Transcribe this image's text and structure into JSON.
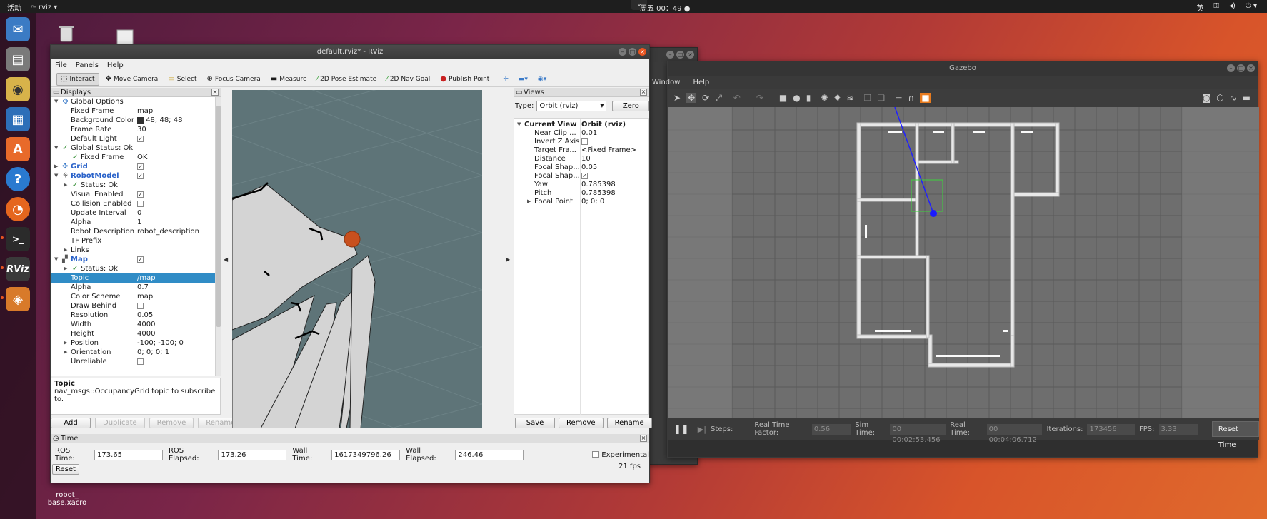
{
  "topbar": {
    "activities": "活动",
    "app_name": "rviz",
    "clock": "周五 00：49 ●",
    "input_method": "英"
  },
  "desktop": {
    "file_label_1": "robot_",
    "file_label_2": "base.xacro"
  },
  "rviz": {
    "title": "default.rviz* - RViz",
    "menu": {
      "file": "File",
      "panels": "Panels",
      "help": "Help"
    },
    "tools": {
      "interact": "Interact",
      "move_camera": "Move Camera",
      "select": "Select",
      "focus_camera": "Focus Camera",
      "measure": "Measure",
      "pose_estimate": "2D Pose Estimate",
      "nav_goal": "2D Nav Goal",
      "publish_point": "Publish Point"
    },
    "displays": {
      "header": "Displays",
      "rows": {
        "global_options": "Global Options",
        "fixed_frame_k": "Fixed Frame",
        "fixed_frame_v": "map",
        "bg_color_k": "Background Color",
        "bg_color_v": "48; 48; 48",
        "frame_rate_k": "Frame Rate",
        "frame_rate_v": "30",
        "default_light_k": "Default Light",
        "global_status": "Global Status: Ok",
        "gs_fixed_frame_k": "Fixed Frame",
        "gs_fixed_frame_v": "OK",
        "grid": "Grid",
        "robot_model": "RobotModel",
        "rm_status": "Status: Ok",
        "visual_enabled": "Visual Enabled",
        "collision_enabled": "Collision Enabled",
        "update_interval_k": "Update Interval",
        "update_interval_v": "0",
        "alpha_k": "Alpha",
        "alpha_v": "1",
        "robot_desc_k": "Robot Description",
        "robot_desc_v": "robot_description",
        "tf_prefix": "TF Prefix",
        "links": "Links",
        "map": "Map",
        "map_status": "Status: Ok",
        "topic_k": "Topic",
        "topic_v": "/map",
        "map_alpha_k": "Alpha",
        "map_alpha_v": "0.7",
        "color_scheme_k": "Color Scheme",
        "color_scheme_v": "map",
        "draw_behind": "Draw Behind",
        "resolution_k": "Resolution",
        "resolution_v": "0.05",
        "width_k": "Width",
        "width_v": "4000",
        "height_k": "Height",
        "height_v": "4000",
        "position_k": "Position",
        "position_v": "-100; -100; 0",
        "orientation_k": "Orientation",
        "orientation_v": "0; 0; 0; 1",
        "unreliable": "Unreliable"
      },
      "desc_title": "Topic",
      "desc_text": "nav_msgs::OccupancyGrid topic to subscribe to.",
      "buttons": {
        "add": "Add",
        "duplicate": "Duplicate",
        "remove": "Remove",
        "rename": "Rename"
      }
    },
    "views": {
      "header": "Views",
      "type_label": "Type:",
      "type_value": "Orbit (rviz)",
      "zero": "Zero",
      "rows": {
        "current_view_k": "Current View",
        "current_view_v": "Orbit (rviz)",
        "near_clip_k": "Near Clip ...",
        "near_clip_v": "0.01",
        "invert_z_k": "Invert Z Axis",
        "target_frame_k": "Target Fra...",
        "target_frame_v": "<Fixed Frame>",
        "distance_k": "Distance",
        "distance_v": "10",
        "focal_shape1_k": "Focal Shap...",
        "focal_shape1_v": "0.05",
        "focal_shape2_k": "Focal Shap...",
        "yaw_k": "Yaw",
        "yaw_v": "0.785398",
        "pitch_k": "Pitch",
        "pitch_v": "0.785398",
        "focal_point_k": "Focal Point",
        "focal_point_v": "0; 0; 0"
      },
      "buttons": {
        "save": "Save",
        "remove": "Remove",
        "rename": "Rename"
      }
    },
    "time": {
      "header": "Time",
      "ros_time_label": "ROS Time:",
      "ros_time": "173.65",
      "ros_elapsed_label": "ROS Elapsed:",
      "ros_elapsed": "173.26",
      "wall_time_label": "Wall Time:",
      "wall_time": "1617349796.26",
      "wall_elapsed_label": "Wall Elapsed:",
      "wall_elapsed": "246.46",
      "experimental": "Experimental",
      "reset": "Reset",
      "fps": "21 fps"
    }
  },
  "gazebo": {
    "title": "Gazebo",
    "menu": {
      "window": "Window",
      "help": "Help"
    },
    "status": {
      "steps_label": "Steps:",
      "rtf_label": "Real Time Factor:",
      "rtf": "0.56",
      "sim_time_label": "Sim Time:",
      "sim_time": "00 00:02:53.456",
      "real_time_label": "Real Time:",
      "real_time": "00 00:04:06.712",
      "iterations_label": "Iterations:",
      "iterations": "173456",
      "fps_label": "FPS:",
      "fps": "3.33",
      "reset_time": "Reset Time"
    }
  },
  "colors": {
    "accent": "#e95420",
    "selection": "#308cc6",
    "viewport_bg": "#5e7478",
    "robot": "#c8501e"
  }
}
